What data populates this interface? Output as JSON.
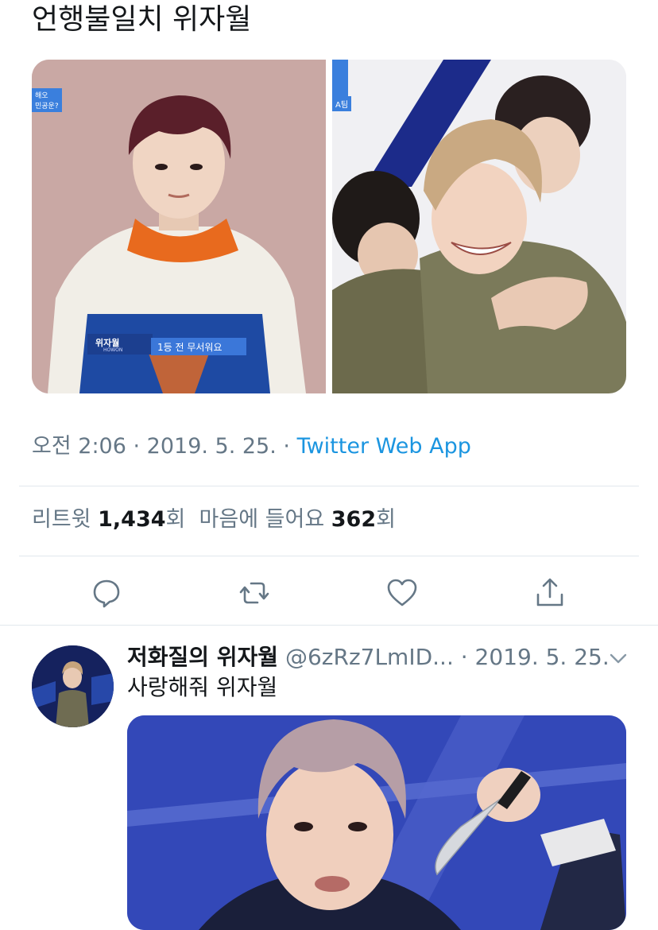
{
  "tweet": {
    "text": "언행불일치 위자월",
    "media": {
      "left_overlay_top": "해오\n민공운?",
      "left_caption_name": "위자월",
      "left_caption_sub": "HOWON",
      "left_caption_text": "1등 전 무서워요",
      "right_overlay_top": "A팀"
    },
    "meta": {
      "time": "오전 2:06",
      "dot1": " · ",
      "date": "2019. 5. 25.",
      "dot2": " · ",
      "source": "Twitter Web App"
    },
    "stats": {
      "retweets_label": "리트윗 ",
      "retweets_count": "1,434",
      "retweets_unit": "회",
      "likes_label": "마음에 들어요 ",
      "likes_count": "362",
      "likes_unit": "회"
    },
    "actions": [
      "reply-icon",
      "retweet-icon",
      "like-icon",
      "share-icon"
    ],
    "colors": {
      "accent": "#1b95e0",
      "muted": "#657786",
      "divider": "#e1e8ed",
      "text": "#14171a"
    }
  },
  "reply": {
    "name": "저화질의 위자월",
    "handle": " @6zRz7LmID...",
    "date": " · 2019. 5. 25.",
    "text": "사랑해줘 위자월"
  }
}
